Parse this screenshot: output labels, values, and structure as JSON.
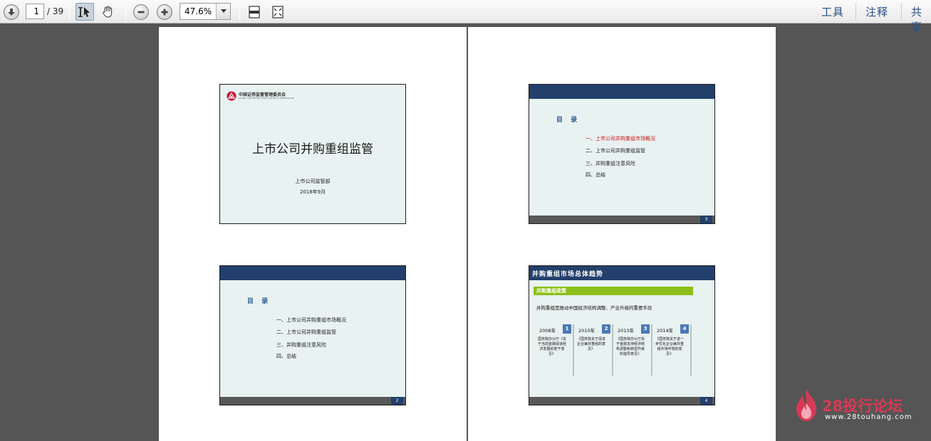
{
  "toolbar": {
    "page_current": "1",
    "page_total": "/ 39",
    "zoom": "47.6%",
    "menu": {
      "tools": "工具",
      "comment": "注释",
      "share": "共享"
    }
  },
  "slides": {
    "s1": {
      "logo_text": "中国证券监督管理委员会",
      "logo_sub": "CHINA SECURITIES REGULATORY COMMISSION",
      "title": "上市公司并购重组监管",
      "dept": "上市公司监管部",
      "date": "2018年9月"
    },
    "s2": {
      "toc_title": "目 录",
      "items": [
        "一、上市公司并购重组市场概况",
        "二、上市公司并购重组监管",
        "三、并购重组注意风险",
        "四、总结"
      ],
      "page": "2"
    },
    "s3": {
      "toc_title": "目 录",
      "items": [
        "一、上市公司并购重组市场概况",
        "二、上市公司并购重组监管",
        "三、并购重组注意风险",
        "四、总结"
      ],
      "page": "3"
    },
    "s4": {
      "title": "并购重组市场总体趋势",
      "green_label": "并购重组政策",
      "desc": "并购重组是推动中国经济结构调整、产业升级的重要手段",
      "timeline": [
        {
          "year": "2008年",
          "num": "1",
          "text": "国务院办公厅《关于当前金融促进经济发展的若干意见》"
        },
        {
          "year": "2010年",
          "num": "2",
          "text": "《国务院关于促进企业兼并重组的意见》"
        },
        {
          "year": "2013年",
          "num": "3",
          "text": "《国务院办公厅关于金融支持经济结构调整和转型升级的指导意见》"
        },
        {
          "year": "2014年",
          "num": "4",
          "text": "《国务院关于进一步优化企业兼并重组市场环境的意见》"
        }
      ],
      "page": "4"
    }
  },
  "watermark": {
    "title": "28投行论坛",
    "site": "www.28touhang.com"
  }
}
